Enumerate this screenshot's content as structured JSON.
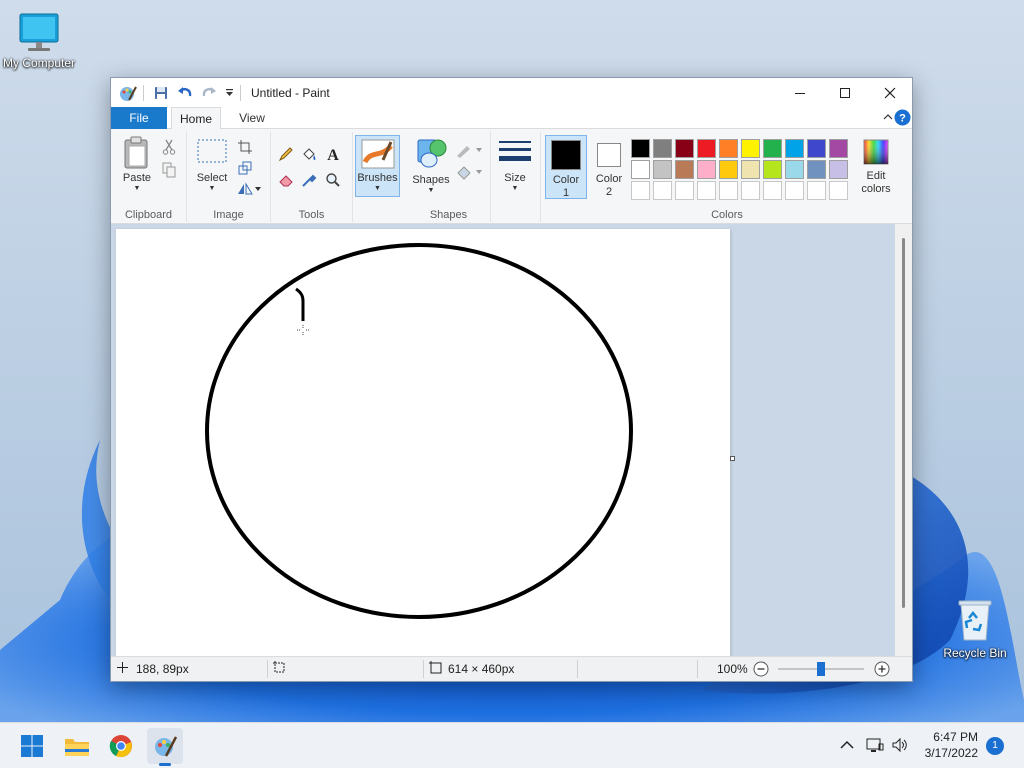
{
  "desktop": {
    "icons": [
      {
        "label": "My Computer"
      },
      {
        "label": "Recycle Bin"
      }
    ]
  },
  "window": {
    "title": "Untitled - Paint",
    "menu": {
      "file": "File",
      "home": "Home",
      "view": "View"
    },
    "ribbon": {
      "clipboard": {
        "label": "Clipboard",
        "paste": "Paste"
      },
      "image": {
        "label": "Image",
        "select": "Select"
      },
      "tools": {
        "label": "Tools"
      },
      "brushes": {
        "label": "Brushes"
      },
      "shapes": {
        "label": "Shapes",
        "button": "Shapes"
      },
      "size": {
        "label": "Size"
      },
      "colors": {
        "label": "Colors",
        "color1": "Color",
        "color1_num": "1",
        "color2": "Color",
        "color2_num": "2",
        "edit": "Edit",
        "edit2": "colors",
        "color1_value": "#000000",
        "color2_value": "#ffffff",
        "palette_row1": [
          "#000000",
          "#7f7f7f",
          "#880015",
          "#ed1c24",
          "#ff7f27",
          "#fff200",
          "#22b14c",
          "#00a2e8",
          "#3f48cc",
          "#a349a4"
        ],
        "palette_row2": [
          "#ffffff",
          "#c3c3c3",
          "#b97a57",
          "#ffaec9",
          "#ffc90e",
          "#efe4b0",
          "#b5e61d",
          "#99d9ea",
          "#7092be",
          "#c8bfe7"
        ]
      }
    },
    "status": {
      "cursor_pos": "188, 89px",
      "canvas_size": "614 × 460px",
      "zoom": "100%",
      "zoom_level": 0.5
    }
  },
  "taskbar": {
    "time": "6:47 PM",
    "date": "3/17/2022",
    "notifications": "1"
  },
  "colors": {
    "accent": "#1979ca",
    "ribbon_bg": "#f5f6f7",
    "workspace_bg": "#cad7e6"
  }
}
